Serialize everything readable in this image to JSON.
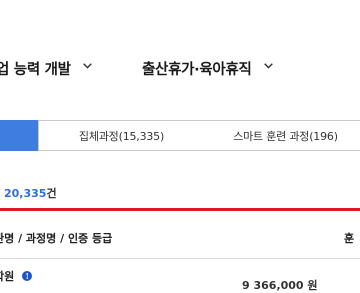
{
  "nav": {
    "items": [
      {
        "label": "업 능력 개발"
      },
      {
        "label": "출산휴가·육아휴직"
      }
    ],
    "chevron_icon": "chevron-down-icon"
  },
  "tabs": [
    {
      "label": "",
      "active": true
    },
    {
      "label": "집체과정(15,335)",
      "active": false
    },
    {
      "label": "스마트 훈련 과정(196)",
      "active": false
    }
  ],
  "result": {
    "count": "20,335",
    "unit": "건"
  },
  "table": {
    "headers": [
      "관명 / 과정명 / 인증 등급",
      "훈"
    ],
    "rows": [
      {
        "institution": "학원",
        "price": "9 366,000 원"
      }
    ]
  },
  "colors": {
    "accent": "#3f7de0",
    "count": "#2d6fd6",
    "divider": "#e3141f",
    "info_icon": "#1f56c6"
  }
}
